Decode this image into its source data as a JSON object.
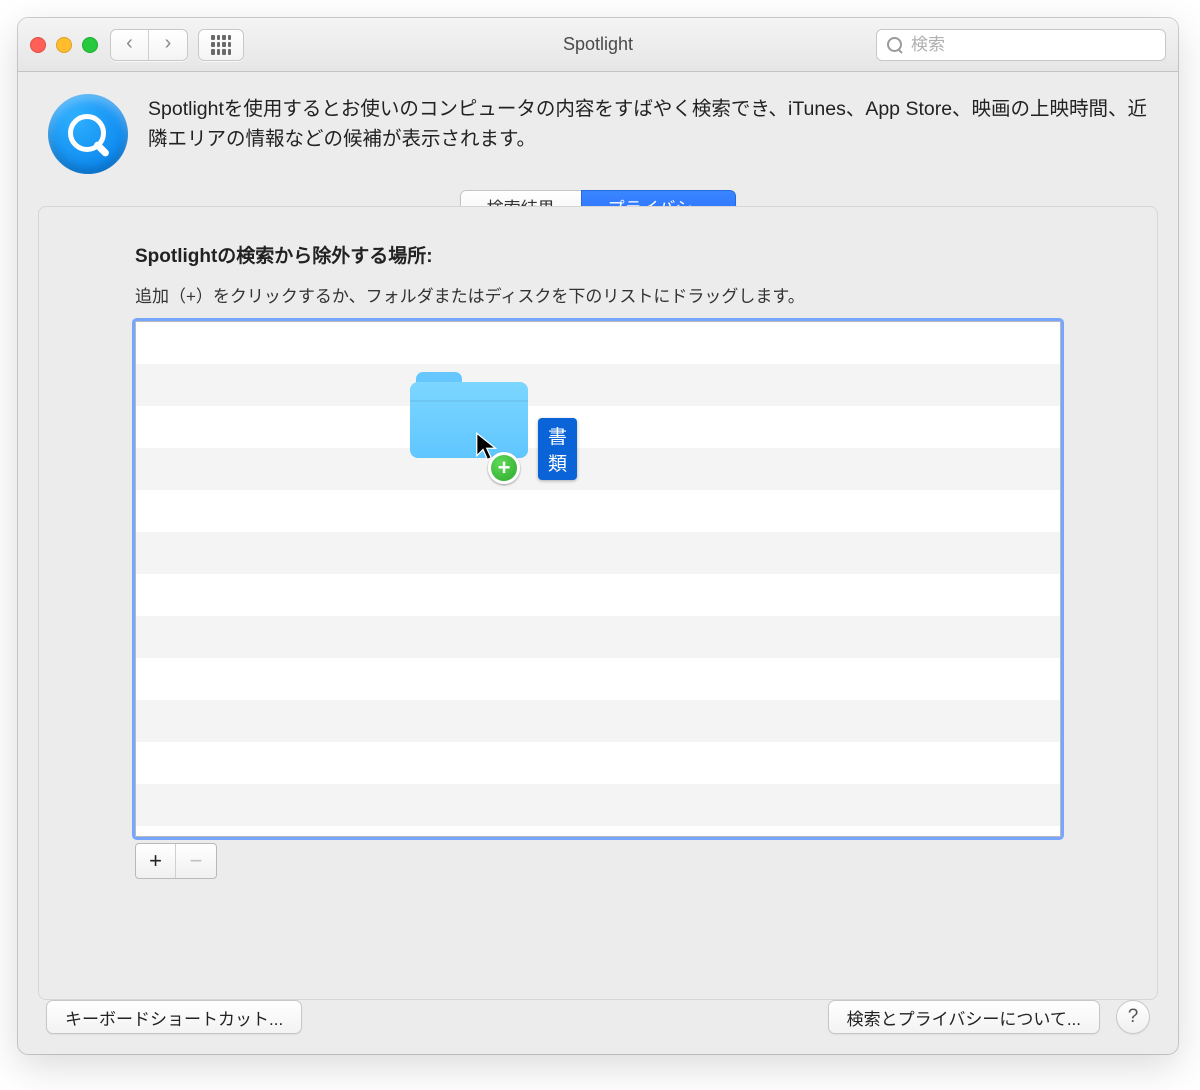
{
  "window": {
    "title": "Spotlight"
  },
  "toolbar": {
    "search_placeholder": "検索"
  },
  "header": {
    "description": "Spotlightを使用するとお使いのコンピュータの内容をすばやく検索でき、iTunes、App Store、映画の上映時間、近隣エリアの情報などの候補が表示されます。"
  },
  "tabs": {
    "search_results": "検索結果",
    "privacy": "プライバシー",
    "active": "privacy"
  },
  "privacy": {
    "heading": "Spotlightの検索から除外する場所:",
    "instruction": "追加（+）をクリックするか、フォルダまたはディスクを下のリストにドラッグします。",
    "dragged_item_label": "書類"
  },
  "buttons": {
    "add": "+",
    "remove": "−",
    "keyboard_shortcuts": "キーボードショートカット...",
    "about": "検索とプライバシーについて...",
    "help": "?"
  }
}
